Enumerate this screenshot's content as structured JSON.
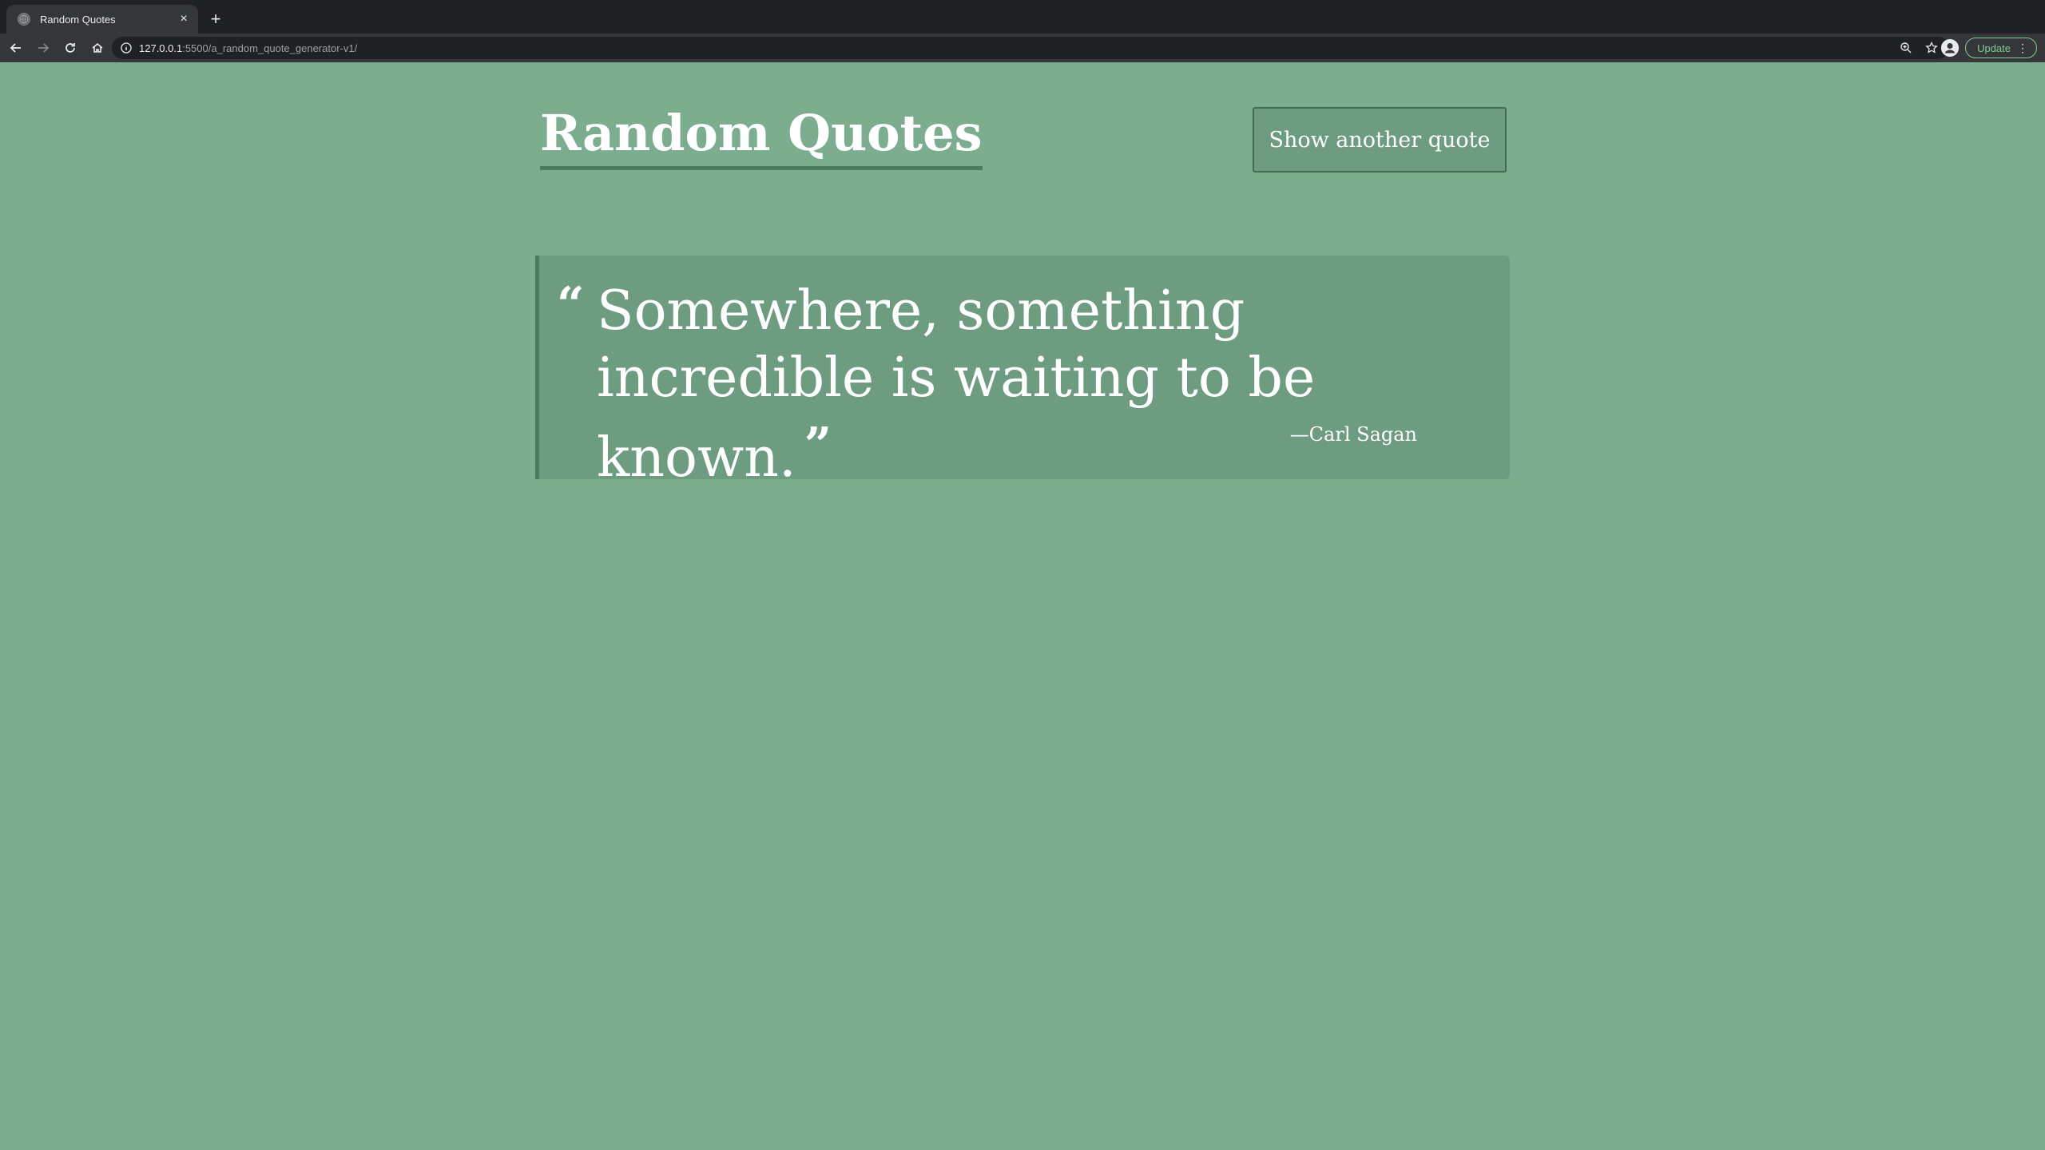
{
  "browser": {
    "tab": {
      "title": "Random Quotes",
      "close_glyph": "×"
    },
    "new_tab_glyph": "+",
    "url": {
      "host": "127.0.0.1",
      "rest": ":5500/a_random_quote_generator-v1/"
    },
    "update_label": "Update",
    "menu_glyph": "⋮"
  },
  "page": {
    "heading": "Random Quotes",
    "button_label": "Show another quote",
    "quote": {
      "open_mark": "“",
      "text": "Somewhere, something incredible is waiting to be known.",
      "close_mark": "”",
      "author": "—Carl Sagan"
    }
  },
  "colors": {
    "page_background": "#7bad8e",
    "panel": "#6e9c80",
    "accent_border": "#4a7d5c",
    "text": "#ffffff"
  }
}
